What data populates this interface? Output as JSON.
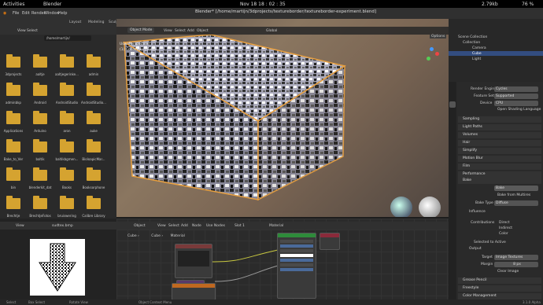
{
  "topbar": {
    "activities": "Activities",
    "app": "Blender",
    "clock": "Nov 18 18 : 02 : 35",
    "net": "2.79kb",
    "battery": "76 %"
  },
  "window_title": "Blender* [/home/martijn/3dprojects/textureborder/textureborder-experiment.blend]",
  "menus": [
    "File",
    "Edit",
    "Render",
    "Window",
    "Help"
  ],
  "workspaces": [
    "Layout",
    "Modeling",
    "Sculpting",
    "UV Editing",
    "Texture Paint",
    "Shading",
    "Animation",
    "Rendering",
    "Compositing",
    "Geometry Nodes",
    "Scripting"
  ],
  "active_workspace": "Shading",
  "scene": "Scene",
  "view_layer": "View Layer",
  "file_browser": {
    "menus": [
      "View",
      "Select"
    ],
    "path": "/home/martijn/",
    "folders": [
      "3dprojects",
      "aaltje",
      "aaltjegerinke...",
      "admin",
      "adminbkp",
      "Android",
      "AndroidStudio",
      "AndroidStudio...",
      "Applications",
      "Arduino",
      "aron",
      "auke",
      "Bake_to_Ver",
      "baltik",
      "baltikbgmen...",
      "BioloapicMar...",
      "bin",
      "blenderkit_dat",
      "Books",
      "Booksorphone",
      "Brechtje",
      "BrechtjeFotos",
      "bruiswering",
      "Calibre Library"
    ]
  },
  "image_editor": {
    "menus": [
      "View"
    ],
    "image": "sudtex.bmp"
  },
  "viewport": {
    "mode": "Object Mode",
    "menus": [
      "View",
      "Select",
      "Add",
      "Object"
    ],
    "info1": "User Perspective",
    "info2": "(1) Collection | Cube",
    "options": "Options",
    "gizmo": "Global"
  },
  "node_editor": {
    "menus": [
      "Object",
      "View",
      "Select",
      "Add",
      "Node"
    ],
    "use_nodes": "Use Nodes",
    "slot": "Slot 1",
    "material": "Material",
    "breadcrumb": [
      "Cube",
      "Cube",
      "Material"
    ]
  },
  "outliner": {
    "title": "Scene Collection",
    "items": [
      "Collection",
      "Camera",
      "Cube",
      "Light"
    ]
  },
  "properties": {
    "render_engine_label": "Render Engine",
    "render_engine": "Cycles",
    "feature_set_label": "Feature Set",
    "feature_set": "Supported",
    "device_label": "Device",
    "device": "CPU",
    "osl": "Open Shading Language",
    "sections": [
      "Sampling",
      "Light Paths",
      "Volumes",
      "Hair",
      "Simplify",
      "Motion Blur",
      "Film",
      "Performance"
    ],
    "bake": "Bake",
    "bake_button": "Bake",
    "bake_multires": "Bake from Multires",
    "bake_type_label": "Bake Type",
    "bake_type": "Diffuse",
    "influence": "Influence",
    "contributions": "Contributions",
    "direct": "Direct",
    "indirect": "Indirect",
    "color": "Color",
    "selected_active": "Selected to Active",
    "output": "Output",
    "target_label": "Target",
    "target": "Image Textures",
    "margin_label": "Margin",
    "margin": "8 px",
    "clear_image": "Clear Image",
    "grease_pencil": "Grease Pencil",
    "freestyle": "Freestyle",
    "color_mgmt": "Color Management"
  },
  "status": {
    "select": "Select",
    "box_select": "Box Select",
    "rotate": "Rotate View",
    "context": "Object Context Menu",
    "version": "3.1.0 Alpha"
  }
}
